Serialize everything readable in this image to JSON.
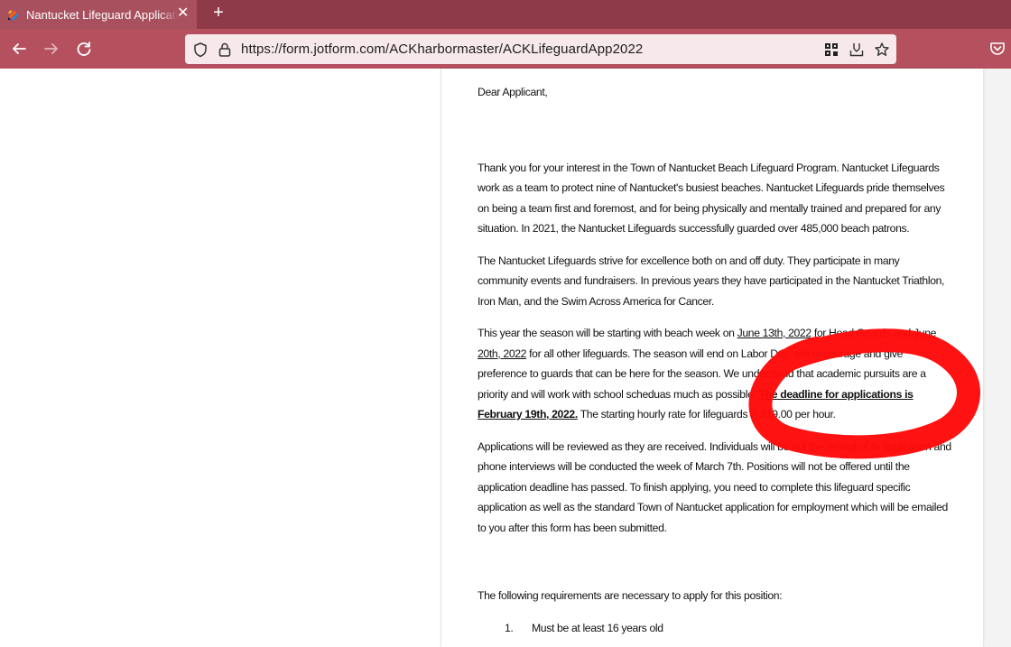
{
  "browser": {
    "tab_title": "Nantucket Lifeguard Application",
    "close_glyph": "✕",
    "new_tab_glyph": "+",
    "url": "https://form.jotform.com/ACKharbormaster/ACKLifeguardApp2022",
    "colors": {
      "tabbar": "#8f3a48",
      "navbar": "#b5515f",
      "urlbar": "#f7e8eb",
      "annotation": "#ff0a0a"
    },
    "icons": [
      "back-arrow-icon",
      "forward-arrow-icon",
      "reload-icon",
      "shield-icon",
      "lock-icon",
      "qr-code-icon",
      "download-tray-icon",
      "bookmark-star-icon",
      "pocket-icon"
    ]
  },
  "letter": {
    "greeting": "Dear Applicant,",
    "p1": "Thank you for your interest in the Town of Nantucket Beach Lifeguard Program. Nantucket Lifeguards work as a team to protect nine of Nantucket's busiest beaches. Nantucket Lifeguards pride themselves on being a team first and foremost, and for being physically and mentally trained and prepared for any situation.  In 2021, the Nantucket Lifeguards successfully guarded over 485,000 beach patrons.",
    "p2": "The Nantucket Lifeguards strive for excellence both on and off duty.  They participate in many community events and fundraisers. In previous years they have participated in the Nantucket Triathlon, Iron Man, and the Swim Across America for Cancer.",
    "p3": {
      "a": "This year the season will be starting with beach week on ",
      "date1": "June 13th, 2022",
      "b": " for Head Guards and ",
      "date2": "June 20th, 2022",
      "c": " for all other lifeguards.  The season will end on Labor Day, whi",
      "d": " encourage and give preference to guards that can be here for the ",
      "e": " season. We understand that academic pursuits are a priority and will work with school schedu",
      "f": "as much as possible.  ",
      "deadline": "The deadline for applications is February 19th, 2022.",
      "g": " The starting hourly rate for",
      "h": " lifeguards is $19.00 per hour."
    },
    "p4": {
      "a": "Applications will be reviewed as they are received.  Individuals will be no",
      "b": "f the receipt of th",
      "c": " application and phone interviews will be conducted the week of March 7th.  Positions will not be offered until the application deadline has passed.  To finish applying, you need to complete this lifeguard specific application as well as the standard Town of Nantucket application for employment which will be emailed to you after this form has been submitted."
    },
    "requirements_intro": "The following requirements are necessary to apply for this position:",
    "requirements": [
      {
        "num": "1.",
        "text": "Must be at least 16 years old"
      }
    ]
  }
}
